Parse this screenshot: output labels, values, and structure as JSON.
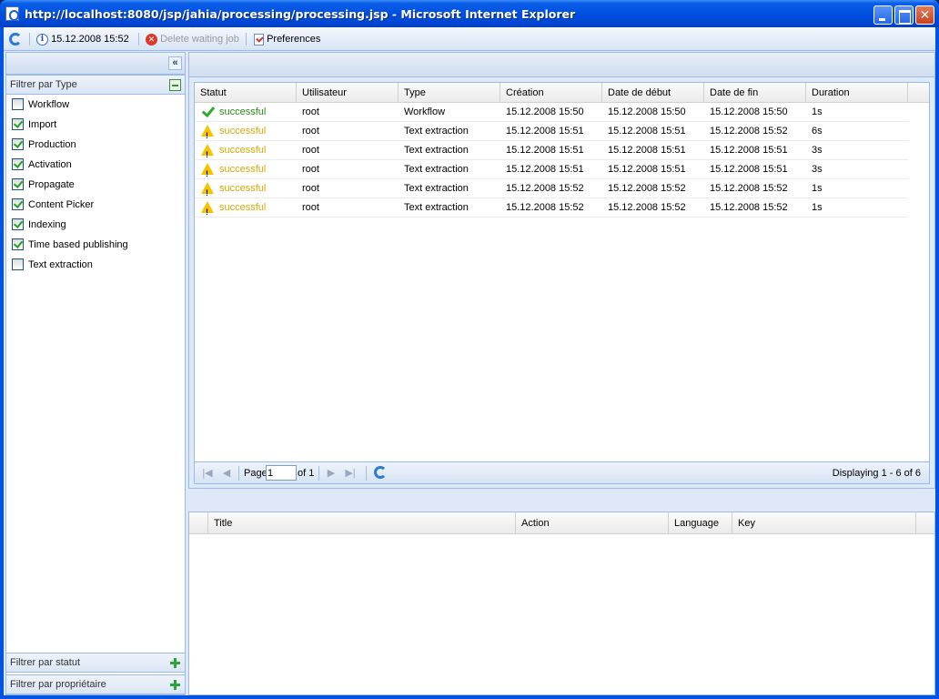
{
  "window": {
    "title": "http://localhost:8080/jsp/jahia/processing/processing.jsp - Microsoft Internet Explorer"
  },
  "toolbar": {
    "refresh_icon": "refresh-icon",
    "datetime": "15.12.2008 15:52",
    "delete_label": "Delete waiting job",
    "preferences_label": "Preferences"
  },
  "left": {
    "collapse_symbol": "«",
    "type_filter_title": "Filtrer par Type",
    "types": [
      {
        "label": "Workflow",
        "checked": false
      },
      {
        "label": "Import",
        "checked": true
      },
      {
        "label": "Production",
        "checked": true
      },
      {
        "label": "Activation",
        "checked": true
      },
      {
        "label": "Propagate",
        "checked": true
      },
      {
        "label": "Content Picker",
        "checked": true
      },
      {
        "label": "Indexing",
        "checked": true
      },
      {
        "label": "Time based publishing",
        "checked": true
      },
      {
        "label": "Text extraction",
        "checked": false
      }
    ],
    "status_filter_title": "Filtrer par statut",
    "owner_filter_title": "Filtrer par propriétaire"
  },
  "grid": {
    "columns": [
      "Statut",
      "Utilisateur",
      "Type",
      "Création",
      "Date de début",
      "Date de fin",
      "Duration"
    ],
    "rows": [
      {
        "icon": "check",
        "status": "successful",
        "user": "root",
        "type": "Workflow",
        "created": "15.12.2008 15:50",
        "start": "15.12.2008 15:50",
        "end": "15.12.2008 15:50",
        "duration": "1s"
      },
      {
        "icon": "warning",
        "status": "successful",
        "user": "root",
        "type": "Text extraction",
        "created": "15.12.2008 15:51",
        "start": "15.12.2008 15:51",
        "end": "15.12.2008 15:52",
        "duration": "6s"
      },
      {
        "icon": "warning",
        "status": "successful",
        "user": "root",
        "type": "Text extraction",
        "created": "15.12.2008 15:51",
        "start": "15.12.2008 15:51",
        "end": "15.12.2008 15:51",
        "duration": "3s"
      },
      {
        "icon": "warning",
        "status": "successful",
        "user": "root",
        "type": "Text extraction",
        "created": "15.12.2008 15:51",
        "start": "15.12.2008 15:51",
        "end": "15.12.2008 15:51",
        "duration": "3s"
      },
      {
        "icon": "warning",
        "status": "successful",
        "user": "root",
        "type": "Text extraction",
        "created": "15.12.2008 15:52",
        "start": "15.12.2008 15:52",
        "end": "15.12.2008 15:52",
        "duration": "1s"
      },
      {
        "icon": "warning",
        "status": "successful",
        "user": "root",
        "type": "Text extraction",
        "created": "15.12.2008 15:52",
        "start": "15.12.2008 15:52",
        "end": "15.12.2008 15:52",
        "duration": "1s"
      }
    ],
    "paging": {
      "page_label": "Page",
      "page_value": "1",
      "of_label": "of 1",
      "displaying": "Displaying 1 - 6 of 6"
    }
  },
  "detail": {
    "columns": [
      "Title",
      "Action",
      "Language",
      "Key"
    ]
  },
  "colors": {
    "success_green": "#2a8a1a",
    "warning_amber": "#d8a800",
    "panel_border": "#99bbe8",
    "titlebar_blue": "#0054e3"
  }
}
